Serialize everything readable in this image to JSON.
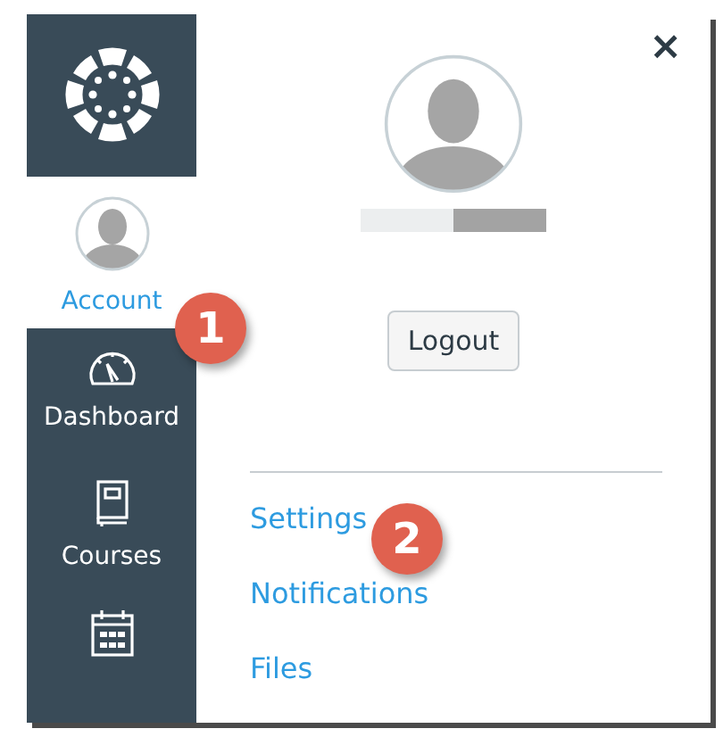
{
  "nav": [
    {
      "label": "Account",
      "selected": true
    },
    {
      "label": "Dashboard",
      "selected": false
    },
    {
      "label": "Courses",
      "selected": false
    },
    {
      "selected": false
    }
  ],
  "tray": {
    "close": "×",
    "button": "Logout",
    "links": [
      "Settings",
      "Notifications",
      "Files"
    ]
  },
  "callouts": [
    "1",
    "2"
  ]
}
